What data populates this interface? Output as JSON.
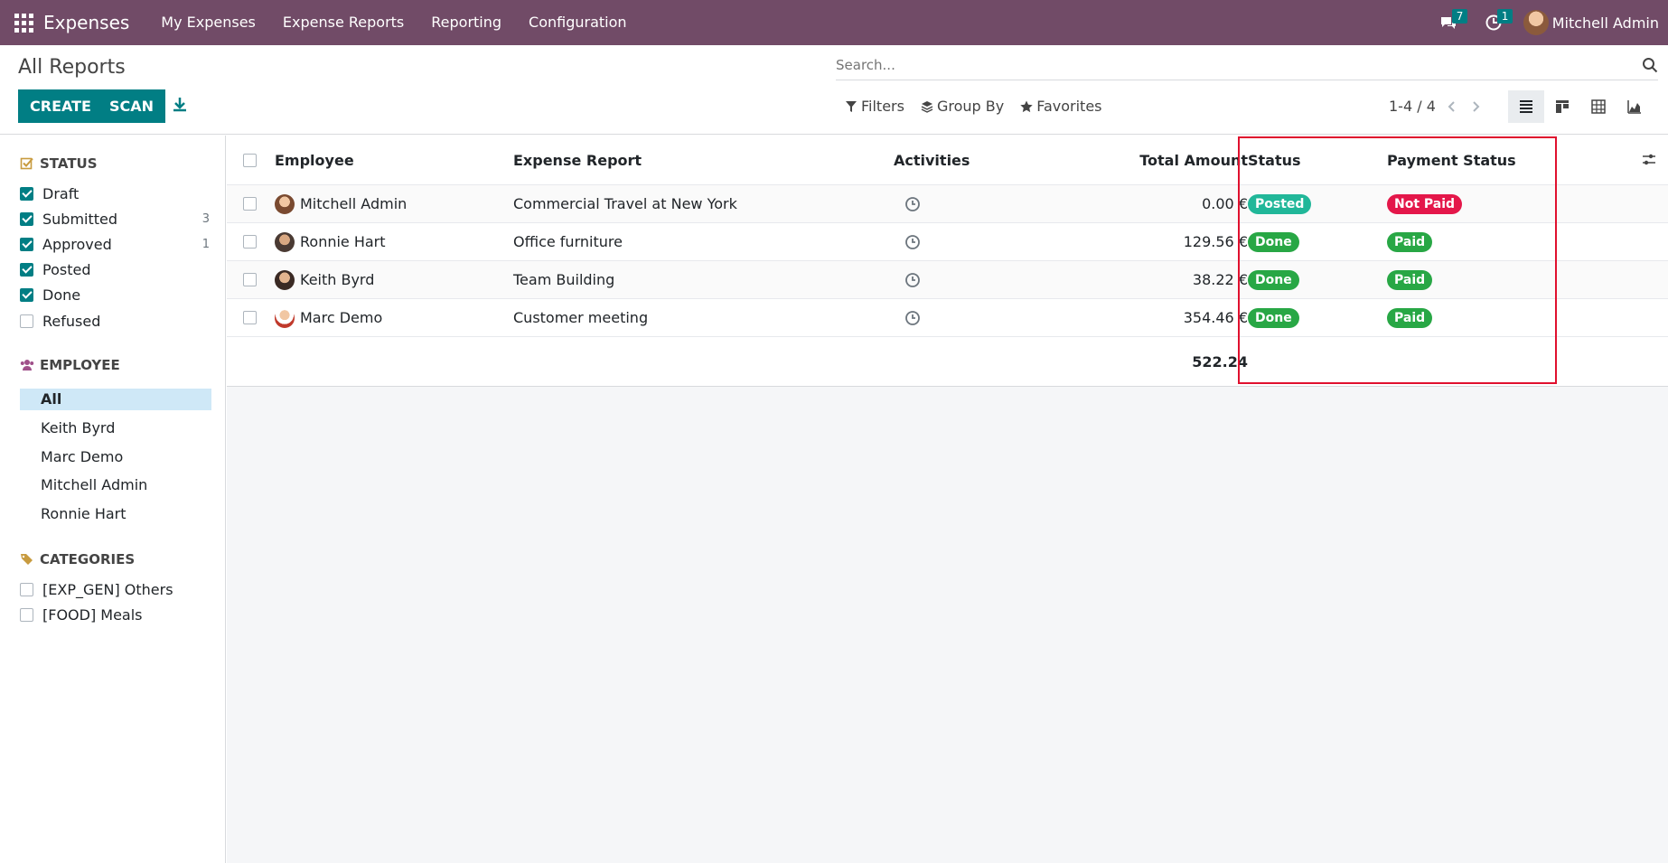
{
  "navbar": {
    "brand": "Expenses",
    "menu": [
      "My Expenses",
      "Expense Reports",
      "Reporting",
      "Configuration"
    ],
    "messages_count": "7",
    "activities_count": "1",
    "user_name": "Mitchell Admin"
  },
  "control_panel": {
    "title": "All Reports",
    "create_label": "CREATE",
    "scan_label": "SCAN",
    "search_placeholder": "Search...",
    "filters_label": "Filters",
    "groupby_label": "Group By",
    "favorites_label": "Favorites",
    "pager": "1-4 / 4"
  },
  "sidebar": {
    "status_title": "STATUS",
    "status_items": [
      {
        "label": "Draft",
        "checked": true,
        "count": ""
      },
      {
        "label": "Submitted",
        "checked": true,
        "count": "3"
      },
      {
        "label": "Approved",
        "checked": true,
        "count": "1"
      },
      {
        "label": "Posted",
        "checked": true,
        "count": ""
      },
      {
        "label": "Done",
        "checked": true,
        "count": ""
      },
      {
        "label": "Refused",
        "checked": false,
        "count": ""
      }
    ],
    "employee_title": "EMPLOYEE",
    "employee_items": [
      "All",
      "Keith Byrd",
      "Marc Demo",
      "Mitchell Admin",
      "Ronnie Hart"
    ],
    "categories_title": "CATEGORIES",
    "category_items": [
      {
        "label": "[EXP_GEN] Others",
        "checked": false
      },
      {
        "label": "[FOOD] Meals",
        "checked": false
      }
    ]
  },
  "table": {
    "headers": {
      "employee": "Employee",
      "report": "Expense Report",
      "activities": "Activities",
      "total": "Total Amount",
      "status": "Status",
      "payment": "Payment Status"
    },
    "rows": [
      {
        "employee": "Mitchell Admin",
        "report": "Commercial Travel at New York",
        "total": "0.00 €",
        "status": "Posted",
        "status_color": "#21b799",
        "payment": "Not Paid",
        "payment_color": "#e4174a"
      },
      {
        "employee": "Ronnie Hart",
        "report": "Office furniture",
        "total": "129.56 €",
        "status": "Done",
        "status_color": "#28a745",
        "payment": "Paid",
        "payment_color": "#28a745"
      },
      {
        "employee": "Keith Byrd",
        "report": "Team Building",
        "total": "38.22 €",
        "status": "Done",
        "status_color": "#28a745",
        "payment": "Paid",
        "payment_color": "#28a745"
      },
      {
        "employee": "Marc Demo",
        "report": "Customer meeting",
        "total": "354.46 €",
        "status": "Done",
        "status_color": "#28a745",
        "payment": "Paid",
        "payment_color": "#28a745"
      }
    ],
    "footer_total": "522.24"
  },
  "colors": {
    "navbar": "#714b67",
    "primary": "#017e84",
    "highlight": "#e0102e"
  }
}
